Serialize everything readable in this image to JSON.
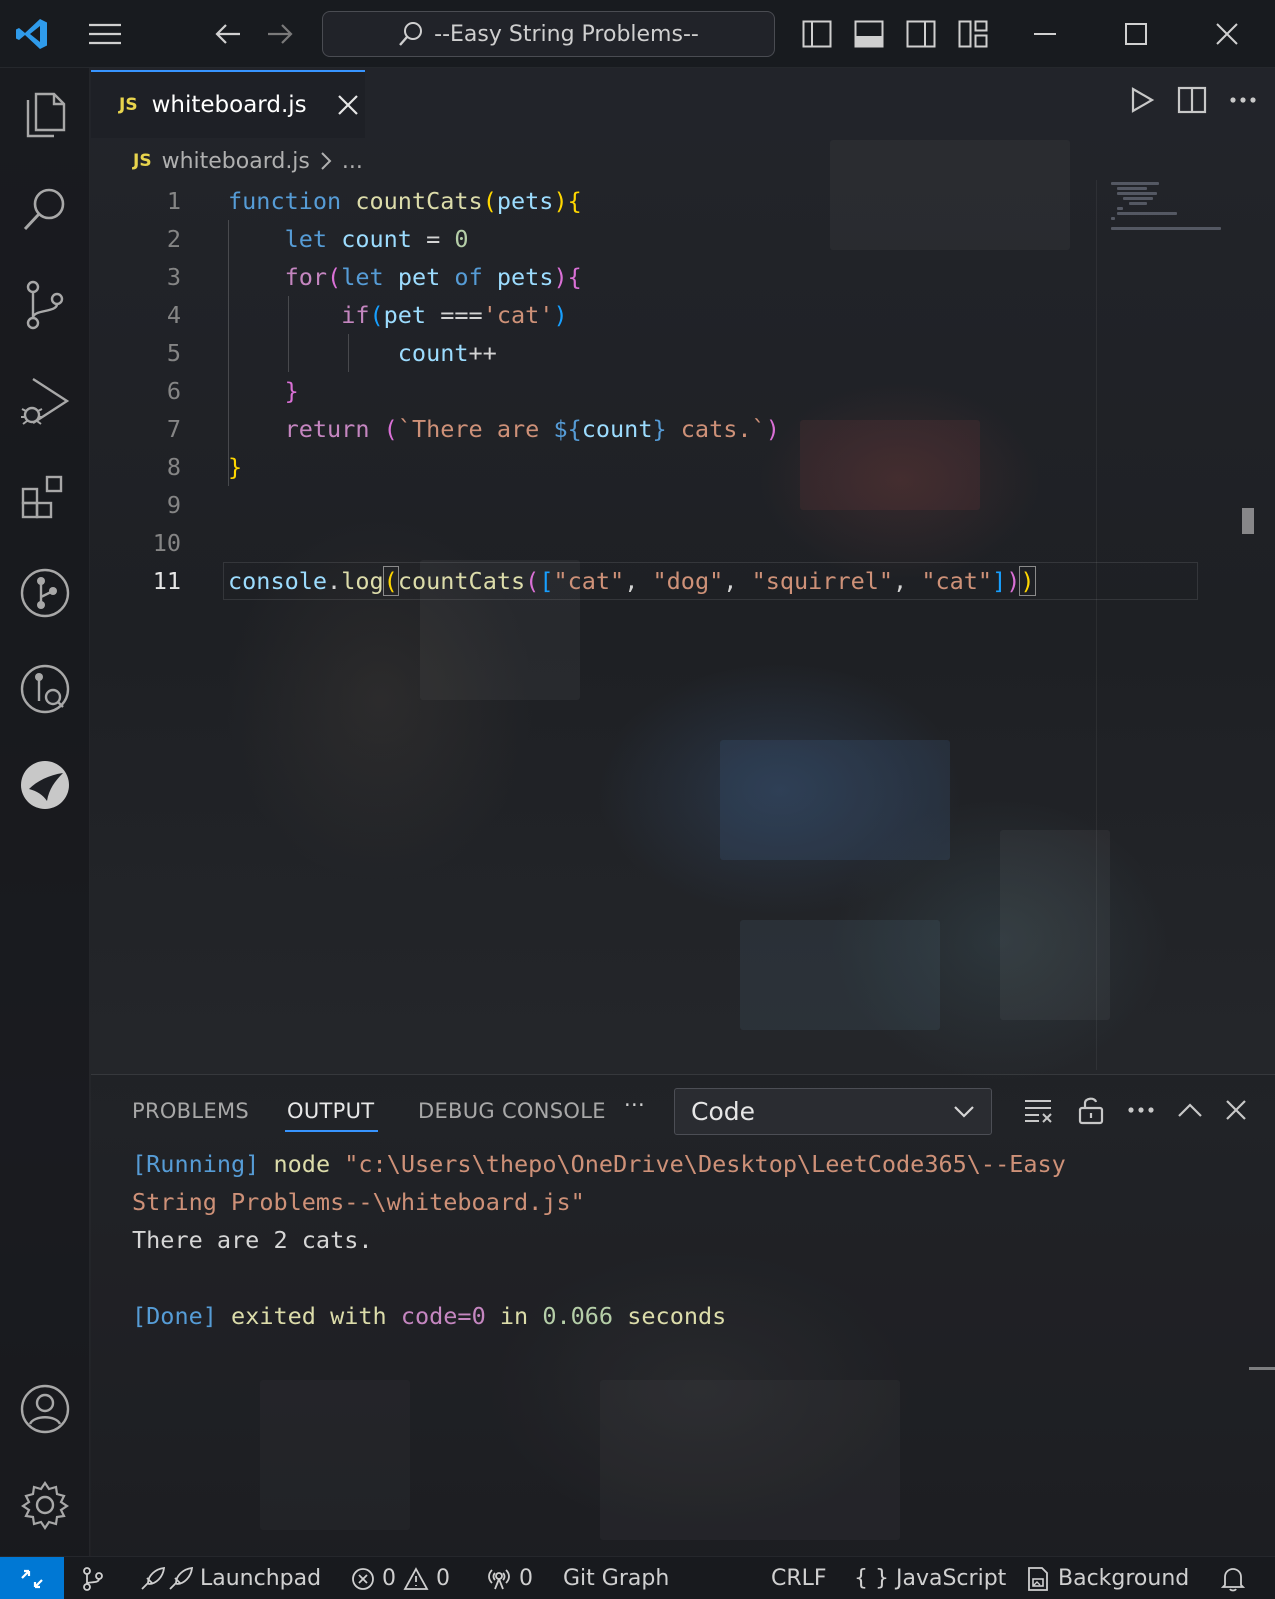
{
  "titlebar": {
    "search_text": "--Easy String Problems--"
  },
  "editor": {
    "tab": {
      "badge": "JS",
      "label": "whiteboard.js"
    },
    "breadcrumb": {
      "badge": "JS",
      "file": "whiteboard.js",
      "more": "..."
    },
    "line_numbers": [
      "1",
      "2",
      "3",
      "4",
      "5",
      "6",
      "7",
      "8",
      "9",
      "10",
      "11"
    ],
    "code_lines": [
      "function countCats(pets){",
      "    let count = 0",
      "    for(let pet of pets){",
      "        if(pet ==='cat')",
      "            count++",
      "    }",
      "    return (`There are ${count} cats.`)",
      "}",
      "",
      "",
      "console.log(countCats([\"cat\", \"dog\", \"squirrel\", \"cat\"]))"
    ]
  },
  "panel": {
    "tabs": [
      "PROBLEMS",
      "OUTPUT",
      "DEBUG CONSOLE"
    ],
    "more_label": "···",
    "channel_select": "Code",
    "output": {
      "running_tag": "[Running]",
      "command": "node",
      "path_line1": "\"c:\\Users\\thepo\\OneDrive\\Desktop\\LeetCode365\\--Easy",
      "path_line2": "String Problems--\\whiteboard.js\"",
      "result": "There are 2 cats.",
      "done_tag": "[Done]",
      "exited_with": "exited with",
      "code_text": "code=0",
      "in_text": "in",
      "seconds_value": "0.066",
      "seconds_text": "seconds"
    }
  },
  "statusbar": {
    "launchpad": "Launchpad",
    "errors": "0",
    "warnings": "0",
    "ports": "0",
    "git_graph": "Git Graph",
    "eol": "CRLF",
    "language_braces": "{ }",
    "language": "JavaScript",
    "background": "Background"
  },
  "colors": {
    "accent": "#3794ff",
    "remote_indicator": "#0078d4",
    "js_badge": "#e8d44d"
  }
}
